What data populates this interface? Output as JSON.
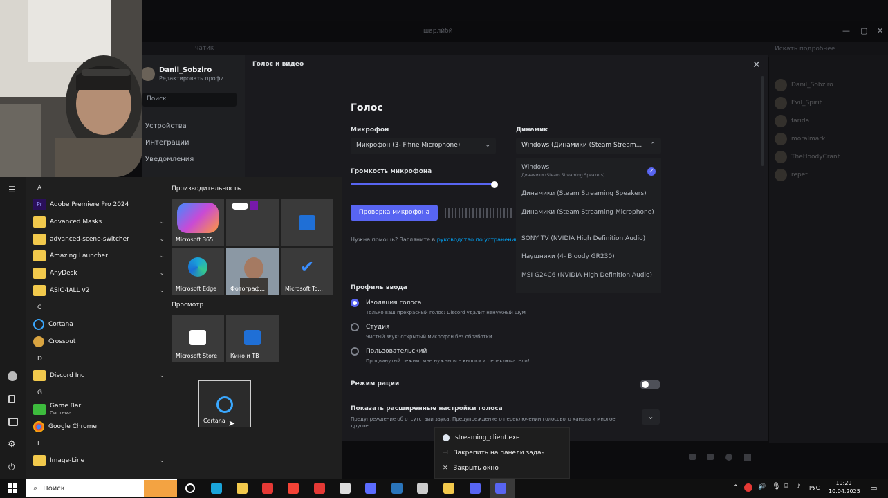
{
  "window": {
    "title": "шарлйбй",
    "channel": "чатик",
    "member_search_placeholder": "Искать подробнее"
  },
  "members": [
    {
      "name": "Danil_Sobziro"
    },
    {
      "name": "Evil_Spirit"
    },
    {
      "name": "farida"
    },
    {
      "name": "moralmark"
    },
    {
      "name": "TheHoodyCrant"
    },
    {
      "name": "repet"
    }
  ],
  "settings": {
    "header": "Голос и видео",
    "profile": {
      "name": "Danil_Sobziro",
      "sub": "Редактировать профи..."
    },
    "search_placeholder": "Поиск",
    "sidebar": [
      {
        "label": "Устройства"
      },
      {
        "label": "Интеграции"
      },
      {
        "label": "Уведомления"
      }
    ],
    "voice": {
      "title": "Голос",
      "mic_label": "Микрофон",
      "mic_value": "Микрофон (3- Fifine Microphone)",
      "speaker_label": "Динамик",
      "speaker_value": "Windows (Динамики (Steam Stream...",
      "mic_volume_label": "Громкость микрофона",
      "mic_volume": 0.98,
      "mic_test_button": "Проверка микрофона",
      "help_prefix": "Нужна помощь? Загляните в ",
      "help_link": "руководство по устранению"
    },
    "speaker_options": [
      {
        "label": "Windows",
        "sub": "Динамики (Steam Streaming Speakers)",
        "selected": true
      },
      {
        "label": "Динамики (Steam Streaming Speakers)"
      },
      {
        "label": "Динамики (Steam Streaming Microphone)"
      },
      {
        "label": "SONY TV (NVIDIA High Definition Audio)"
      },
      {
        "label": "Наушники (4- Bloody GR230)"
      },
      {
        "label": "MSI G24C6 (NVIDIA High Definition Audio)"
      }
    ],
    "input_profile": {
      "title": "Профиль ввода",
      "options": [
        {
          "label": "Изоляция голоса",
          "desc": "Только ваш прекрасный голос: Discord удалит ненужный шум",
          "selected": true
        },
        {
          "label": "Студия",
          "desc": "Чистый звук: открытый микрофон без обработки",
          "selected": false
        },
        {
          "label": "Пользовательский",
          "desc": "Продвинутый режим: мне нужны все кнопки и переключатели!",
          "selected": false
        }
      ]
    },
    "radio_mode": {
      "label": "Режим рации",
      "enabled": false
    },
    "advanced": {
      "title": "Показать расширенные настройки голоса",
      "desc": "Предупреждение об отсутствии звука, Предупреждение о переключении голосового канала и многое другое"
    }
  },
  "start_menu": {
    "apps": [
      {
        "letter": "A"
      },
      {
        "name": "Adobe Premiere Pro 2024",
        "icon": "premiere-icon",
        "folder": false
      },
      {
        "name": "Advanced Masks",
        "folder": true
      },
      {
        "name": "advanced-scene-switcher",
        "folder": true
      },
      {
        "name": "Amazing Launcher",
        "folder": true
      },
      {
        "name": "AnyDesk",
        "folder": true
      },
      {
        "name": "ASIO4ALL v2",
        "folder": true
      },
      {
        "letter": "C"
      },
      {
        "name": "Cortana",
        "icon": "cortana-icon",
        "folder": false
      },
      {
        "name": "Crossout",
        "icon": "crossout-icon",
        "folder": false
      },
      {
        "letter": "D"
      },
      {
        "name": "Discord Inc",
        "folder": true
      },
      {
        "letter": "G"
      },
      {
        "name": "Game Bar",
        "sub": "Система",
        "icon": "gamebar-icon",
        "folder": false
      },
      {
        "name": "Google Chrome",
        "icon": "chrome-icon",
        "folder": false
      },
      {
        "letter": "I"
      },
      {
        "name": "Image-Line",
        "folder": true
      }
    ],
    "groups": [
      {
        "title": "Производительность",
        "tiles": [
          {
            "label": "Microsoft 365...",
            "icon": "m365-icon",
            "color": "#c84ad6"
          },
          {
            "label": "",
            "icon": "onedrive-onenote-icon",
            "color": "#3a3a3a"
          },
          {
            "label": "",
            "icon": "outlook-icon",
            "color": "#3a3a3a"
          },
          {
            "label": "Microsoft Edge",
            "icon": "edge-icon",
            "color": "#3a3a3a"
          },
          {
            "label": "Фотограф...",
            "icon": "photos-icon",
            "color": "#6f7c8a"
          },
          {
            "label": "Microsoft To...",
            "icon": "todo-icon",
            "color": "#3a3a3a"
          }
        ]
      },
      {
        "title": "Просмотр",
        "tiles": [
          {
            "label": "Microsoft Store",
            "icon": "store-icon",
            "color": "#3a3a3a"
          },
          {
            "label": "Кино и ТВ",
            "icon": "movies-icon",
            "color": "#3a3a3a"
          }
        ]
      }
    ],
    "drag_tile": {
      "label": "Cortana",
      "icon": "cortana-icon"
    }
  },
  "jumplist": {
    "items": [
      {
        "label": "streaming_client.exe",
        "icon": "steam-icon"
      },
      {
        "label": "Закрепить на панели задач",
        "icon": "pin-icon"
      },
      {
        "label": "Закрыть окно",
        "icon": "close-icon"
      }
    ]
  },
  "taskbar": {
    "search_placeholder": "Поиск",
    "lang": "РУС",
    "time": "19:29",
    "date": "10.04.2025",
    "apps": [
      {
        "name": "task-view-icon",
        "color": "#ffffff"
      },
      {
        "name": "edge-icon",
        "color": "#1aa4d9"
      },
      {
        "name": "explorer-icon",
        "color": "#f2c94c"
      },
      {
        "name": "yandex-icon",
        "color": "#e53935"
      },
      {
        "name": "yandex-browser-icon",
        "color": "#f44336"
      },
      {
        "name": "wps-icon",
        "color": "#e53935"
      },
      {
        "name": "unity-icon",
        "color": "#dddddd"
      },
      {
        "name": "streamlabs-icon",
        "color": "#5b6cff"
      },
      {
        "name": "steam-icon",
        "color": "#2a75bb"
      },
      {
        "name": "terminal-icon",
        "color": "#cccccc"
      },
      {
        "name": "lock-app-icon",
        "color": "#f2c94c"
      },
      {
        "name": "discord-icon",
        "color": "#5865f2"
      },
      {
        "name": "discord-active-icon",
        "color": "#5865f2"
      }
    ]
  }
}
